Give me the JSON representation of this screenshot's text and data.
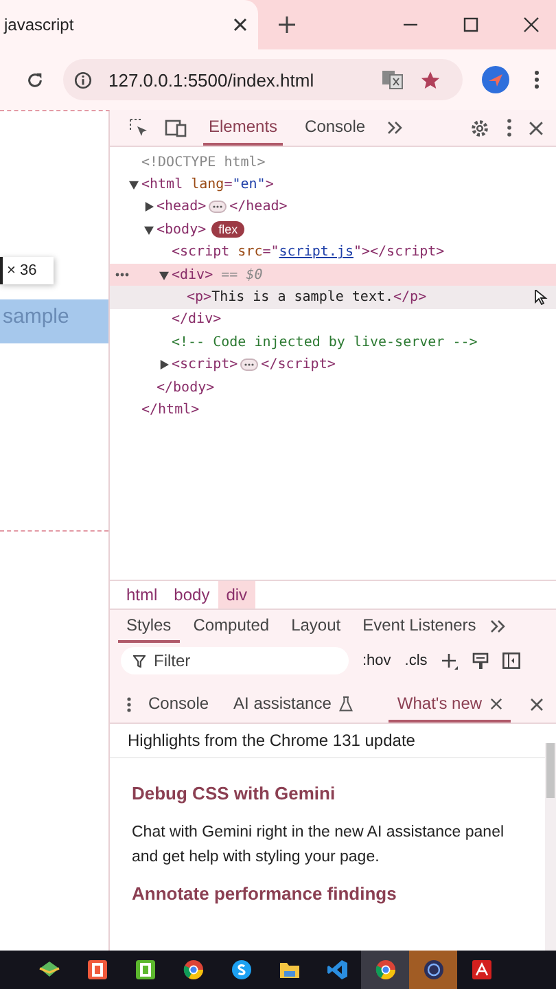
{
  "browser": {
    "tab": {
      "title": "javascript"
    },
    "url": "127.0.0.1:5500/index.html"
  },
  "page": {
    "tooltip": "× 36",
    "highlight_text": "sample"
  },
  "devtools": {
    "tabs": [
      {
        "label": "Elements",
        "selected": true
      },
      {
        "label": "Console",
        "selected": false
      }
    ],
    "dom": [
      {
        "parts": [
          {
            "kind": "doctype",
            "t": "<!DOCTYPE html>"
          }
        ]
      },
      {
        "parts": [
          {
            "kind": "tag",
            "t": "<html "
          },
          {
            "kind": "attr",
            "t": "lang"
          },
          {
            "kind": "tag",
            "t": "="
          },
          {
            "kind": "value",
            "t": "\"en\""
          },
          {
            "kind": "tag",
            "t": ">"
          }
        ],
        "expanded": true,
        "close": [
          {
            "kind": "tag",
            "t": "</html>"
          }
        ],
        "children": [
          {
            "parts": [
              {
                "kind": "tag",
                "t": "<head>"
              }
            ],
            "expanded": false,
            "close": [
              {
                "kind": "tag",
                "t": "</head>"
              }
            ]
          },
          {
            "parts": [
              {
                "kind": "tag",
                "t": "<body>"
              }
            ],
            "badge": "flex",
            "expanded": true,
            "close": [
              {
                "kind": "tag",
                "t": "</body>"
              }
            ],
            "children": [
              {
                "parts": [
                  {
                    "kind": "tag",
                    "t": "<script "
                  },
                  {
                    "kind": "attr",
                    "t": "src"
                  },
                  {
                    "kind": "tag",
                    "t": "=\""
                  },
                  {
                    "kind": "link",
                    "t": "script.js"
                  },
                  {
                    "kind": "tag",
                    "t": "\"></script>"
                  }
                ]
              },
              {
                "parts": [
                  {
                    "kind": "tag",
                    "t": "<div>"
                  },
                  {
                    "kind": "ref",
                    "t": " == $0"
                  }
                ],
                "expanded": true,
                "selected": true,
                "close": [
                  {
                    "kind": "tag",
                    "t": "</div>"
                  }
                ],
                "children": [
                  {
                    "parts": [
                      {
                        "kind": "tag",
                        "t": "<p>"
                      },
                      {
                        "kind": "text",
                        "t": "This is a sample text."
                      },
                      {
                        "kind": "tag",
                        "t": "</p>"
                      }
                    ],
                    "hovered": true
                  }
                ]
              },
              {
                "parts": [
                  {
                    "kind": "comment",
                    "t": "<!-- Code injected by live-server -->"
                  }
                ]
              },
              {
                "parts": [
                  {
                    "kind": "tag",
                    "t": "<script>"
                  }
                ],
                "expanded": false,
                "close": [
                  {
                    "kind": "tag",
                    "t": "</script>"
                  }
                ]
              }
            ]
          }
        ]
      }
    ],
    "breadcrumbs": [
      {
        "label": "html",
        "selected": false
      },
      {
        "label": "body",
        "selected": false
      },
      {
        "label": "div",
        "selected": true
      }
    ],
    "style_tabs": [
      {
        "label": "Styles",
        "selected": true
      },
      {
        "label": "Computed",
        "selected": false
      },
      {
        "label": "Layout",
        "selected": false
      },
      {
        "label": "Event Listeners",
        "selected": false
      }
    ],
    "filter": {
      "placeholder": "Filter"
    },
    "style_tools": [
      ":hov",
      ".cls"
    ],
    "drawer": {
      "tabs": [
        {
          "label": "Console",
          "selected": false,
          "experimental": false,
          "closable": false
        },
        {
          "label": "AI assistance",
          "selected": false,
          "experimental": true,
          "closable": false
        },
        {
          "label": "What's new",
          "selected": true,
          "experimental": false,
          "closable": true
        }
      ],
      "header": "Highlights from the Chrome 131 update",
      "sections": [
        {
          "kind": "heading",
          "text": "Debug CSS with Gemini"
        },
        {
          "kind": "paragraph",
          "text": "Chat with Gemini right in the new AI assistance panel and get help with styling your page."
        },
        {
          "kind": "heading",
          "text": "Annotate performance findings"
        }
      ]
    }
  },
  "taskbar": {
    "apps": [
      {
        "kind": "gem",
        "active": false,
        "attention": false
      },
      {
        "kind": "tile",
        "color": "#f05a3c",
        "active": false,
        "attention": false
      },
      {
        "kind": "tile",
        "color": "#5cb82e",
        "active": false,
        "attention": false
      },
      {
        "kind": "browser",
        "active": false,
        "attention": false
      },
      {
        "kind": "chat",
        "active": false,
        "attention": false
      },
      {
        "kind": "folder",
        "active": false,
        "attention": false
      },
      {
        "kind": "editor",
        "active": false,
        "attention": false
      },
      {
        "kind": "browser",
        "active": true,
        "attention": false
      },
      {
        "kind": "emulator",
        "active": false,
        "attention": true
      },
      {
        "kind": "document",
        "active": false,
        "attention": false
      }
    ]
  }
}
